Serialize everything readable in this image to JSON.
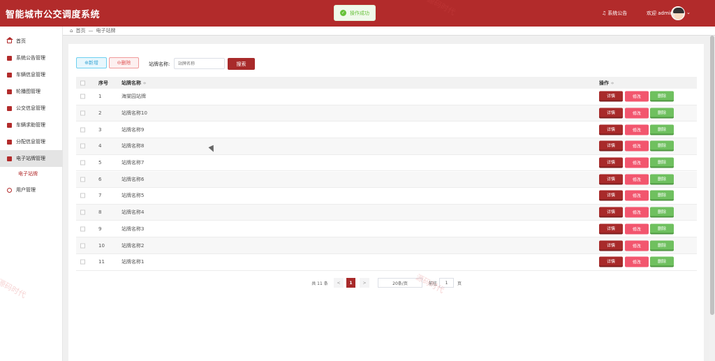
{
  "header": {
    "app_title": "智能城市公交调度系统",
    "toast_text": "操作成功",
    "announcement": "系统公告",
    "welcome": "欢迎 admin"
  },
  "sidebar": {
    "items": [
      {
        "label": "首页",
        "icon": "home-icon"
      },
      {
        "label": "系统公告管理",
        "icon": "notice-icon"
      },
      {
        "label": "车辆信息管理",
        "icon": "vehicle-icon"
      },
      {
        "label": "轮播图管理",
        "icon": "carousel-icon"
      },
      {
        "label": "公交信息管理",
        "icon": "bus-icon"
      },
      {
        "label": "车辆求助管理",
        "icon": "help-icon"
      },
      {
        "label": "分配信息管理",
        "icon": "assign-icon"
      },
      {
        "label": "电子站牌管理",
        "icon": "sign-icon"
      },
      {
        "label": "用户管理",
        "icon": "user-icon"
      }
    ],
    "active_index": 7,
    "submenu_item": "电子站牌"
  },
  "breadcrumb": {
    "home": "首页",
    "separator": "—",
    "current": "电子站牌"
  },
  "toolbar": {
    "add_label": "⊕新增",
    "delete_label": "⊖删除",
    "search_label": "站牌名称:",
    "search_placeholder": "站牌名称",
    "search_button": "搜索"
  },
  "table": {
    "headers": {
      "index": "序号",
      "name": "站牌名称",
      "actions": "操作",
      "sort_icon": "≑"
    },
    "rows": [
      {
        "index": "1",
        "name": "海棠园站牌"
      },
      {
        "index": "2",
        "name": "站牌名称10"
      },
      {
        "index": "3",
        "name": "站牌名称9"
      },
      {
        "index": "4",
        "name": "站牌名称8"
      },
      {
        "index": "5",
        "name": "站牌名称7"
      },
      {
        "index": "6",
        "name": "站牌名称6"
      },
      {
        "index": "7",
        "name": "站牌名称5"
      },
      {
        "index": "8",
        "name": "站牌名称4"
      },
      {
        "index": "9",
        "name": "站牌名称3"
      },
      {
        "index": "10",
        "name": "站牌名称2"
      },
      {
        "index": "11",
        "name": "站牌名称1"
      }
    ],
    "action_labels": {
      "detail": "详情",
      "edit": "修改",
      "remove": "删除"
    }
  },
  "pagination": {
    "total": "共 11 条",
    "prev": "<",
    "current_page": "1",
    "next": ">",
    "page_size": "20条/页",
    "goto_label": "前往",
    "goto_value": "1",
    "goto_unit": "页"
  },
  "watermark": "源码时代"
}
